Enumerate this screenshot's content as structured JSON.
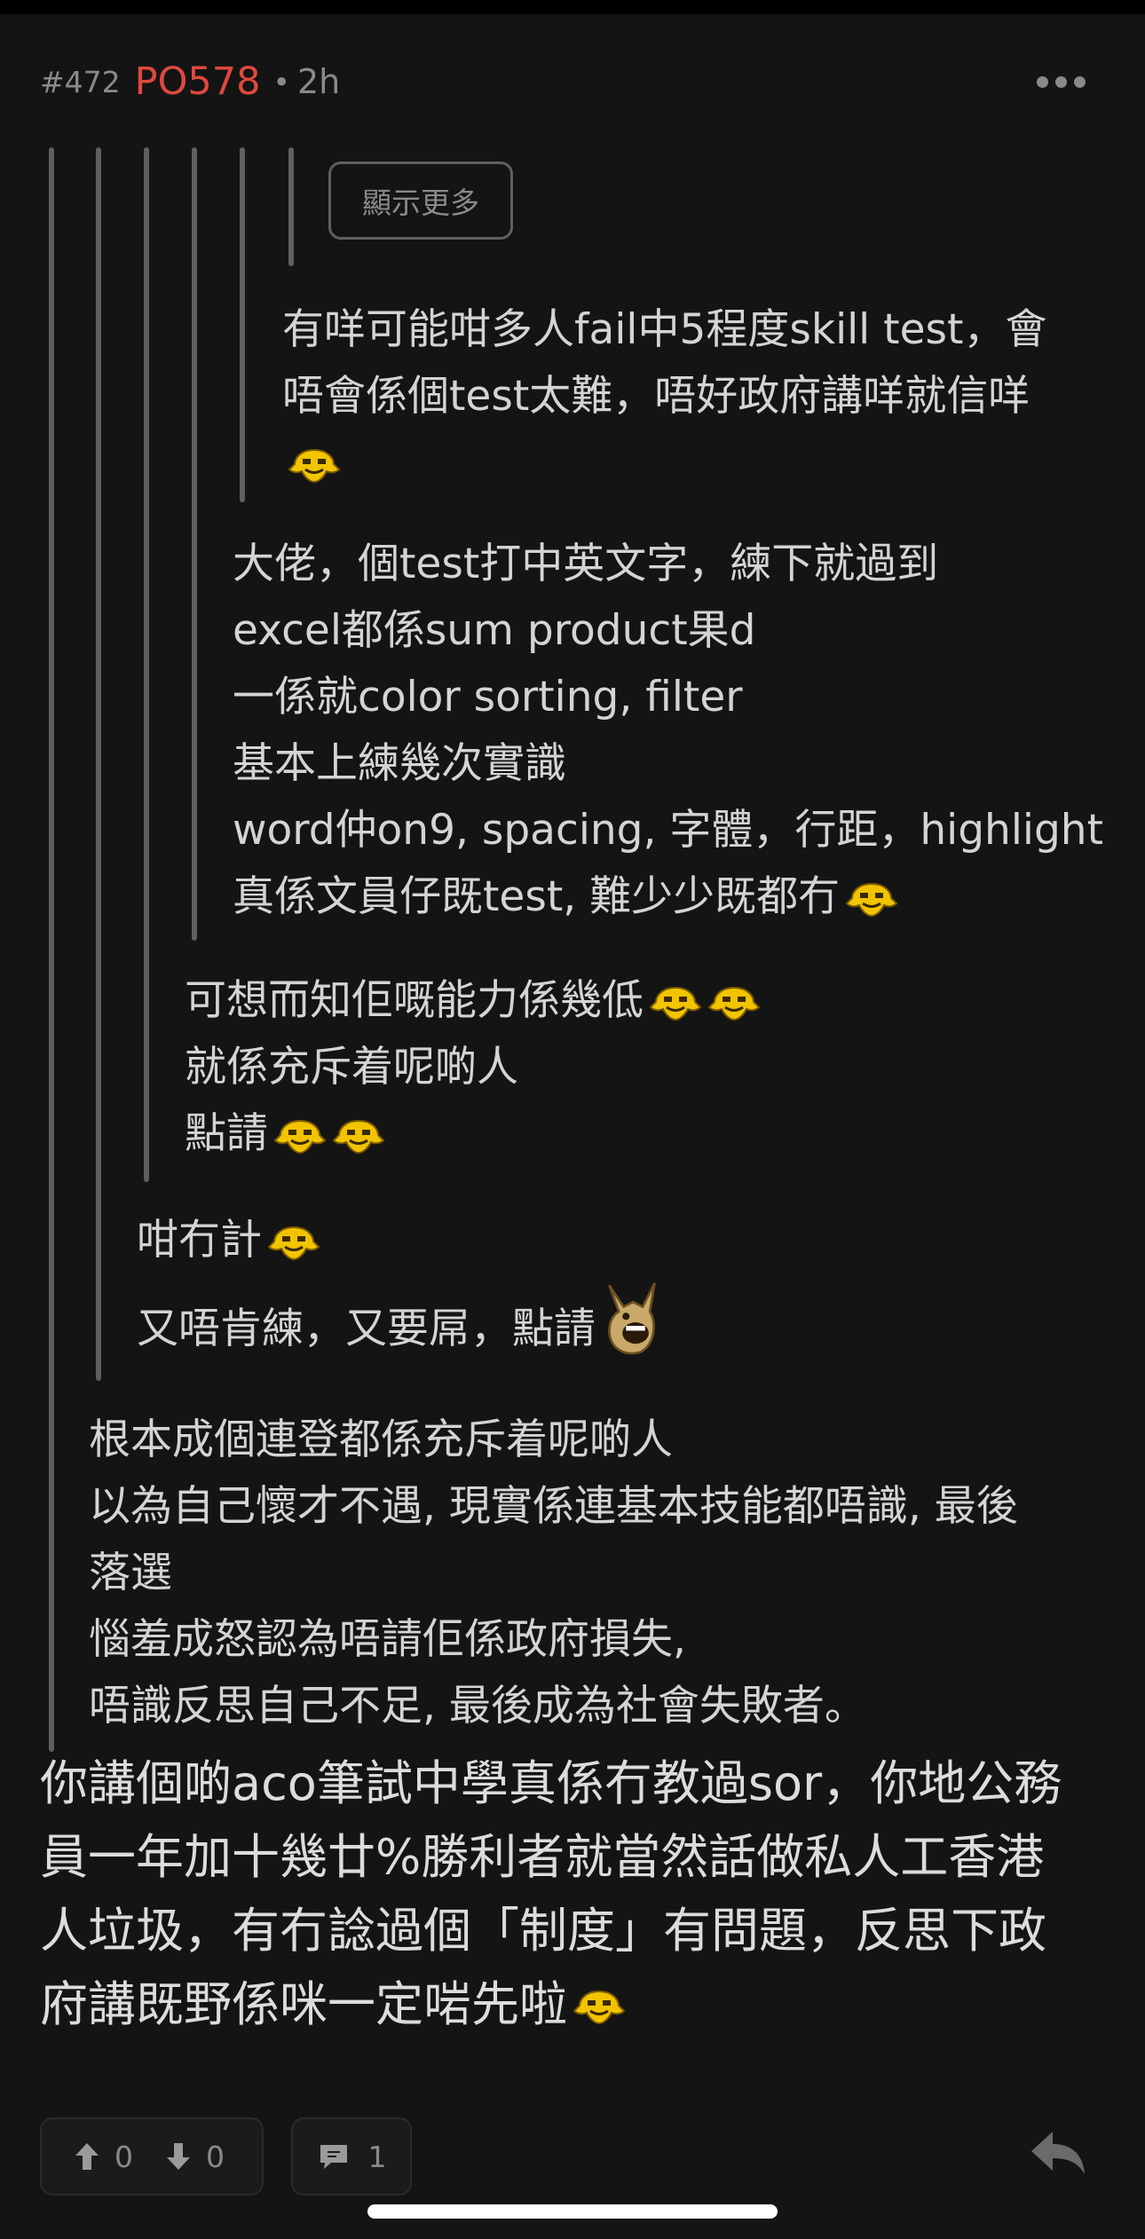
{
  "post": {
    "number": "#472",
    "author": "PO578",
    "separator": "•",
    "time": "2h"
  },
  "show_more_label": "顯示更多",
  "quotes": {
    "q5": [
      "有咩可能咁多人fail中5程度skill test，會",
      "唔會係個test太難，唔好政府講咩就信咩",
      ""
    ],
    "q4": [
      "大佬，個test打中英文字，練下就過到",
      "excel都係sum product果d",
      "一係就color sorting, filter",
      "基本上練幾次實識",
      "word仲on9, spacing, 字體，行距，highlight",
      "真係文員仔既test, 難少少既都冇"
    ],
    "q3": [
      "可想而知佢嘅能力係幾低",
      "就係充斥着呢啲人",
      "點請"
    ],
    "q2a": "咁冇計",
    "q2b": "又唔肯練，又要屌，點請",
    "q1": [
      "根本成個連登都係充斥着呢啲人",
      "以為自己懷才不遇, 現實係連基本技能都唔識, 最後",
      "落選",
      "惱羞成怒認為唔請佢係政府損失,",
      "唔識反思自己不足, 最後成為社會失敗者。"
    ]
  },
  "main_text": [
    "你講個啲aco筆試中學真係冇教過sor，你地公務",
    "員一年加十幾廿%勝利者就當然話做私人工香港",
    "人垃圾，有冇諗過個「制度」有問題，反思下政",
    "府講既野係咪一定啱先啦"
  ],
  "footer": {
    "upvotes": "0",
    "downvotes": "0",
    "replies": "1"
  },
  "icons": {
    "more": "more-dots-icon",
    "emoji": "lihkg-smile-emoji",
    "emoji_alt": "lihkg-angry-emoji",
    "upvote": "arrow-up-icon",
    "downvote": "arrow-down-icon",
    "comment": "comment-icon",
    "reply": "reply-icon"
  },
  "colors": {
    "background": "#141414",
    "author": "#e0483e",
    "text": "#dcdcdc",
    "muted": "#8a8a8a",
    "quote_line": "#5f5f5f"
  }
}
